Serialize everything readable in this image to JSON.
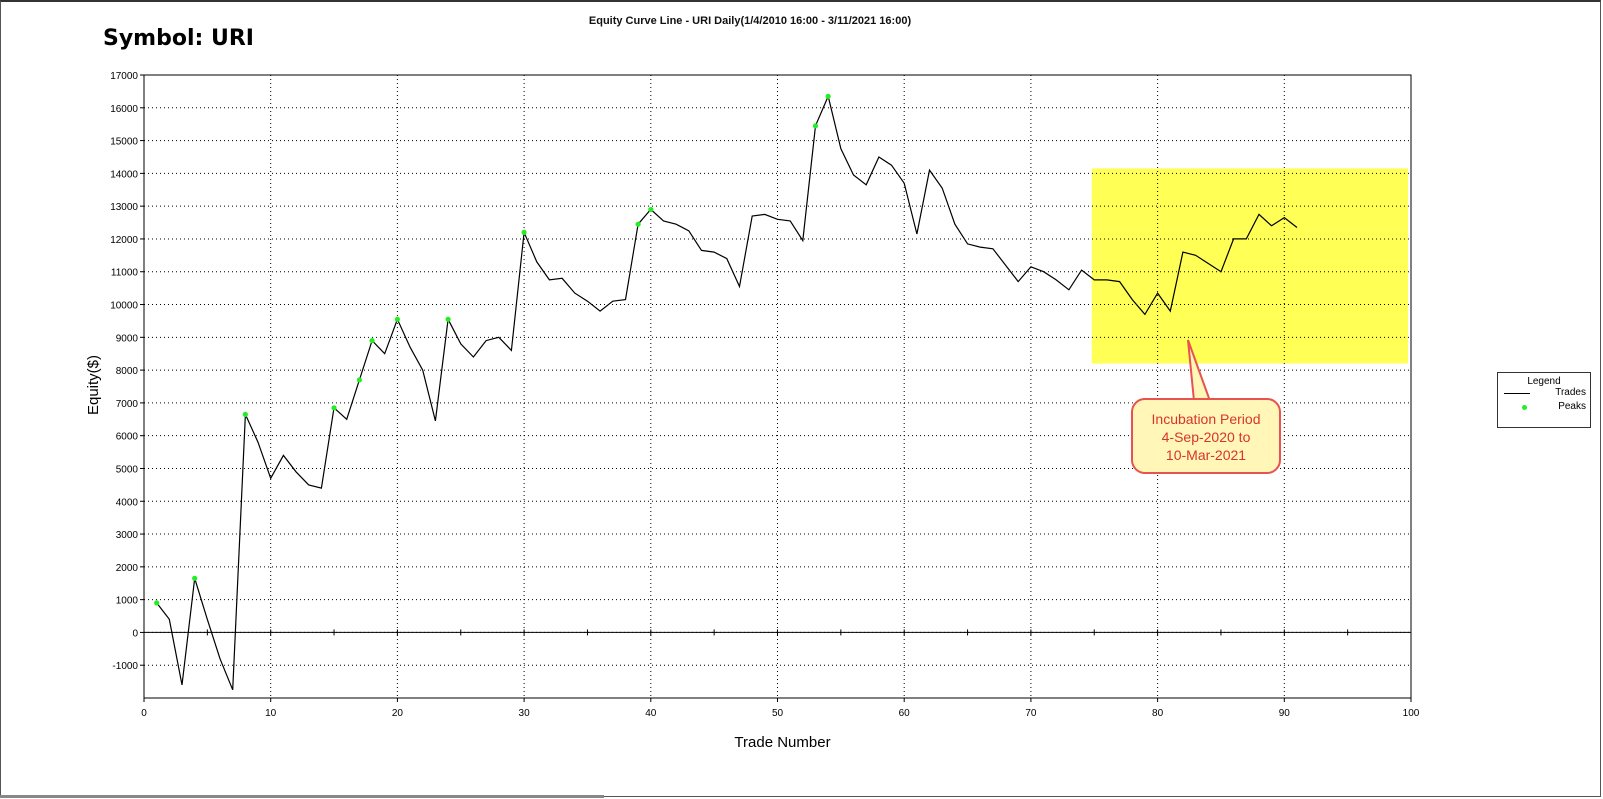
{
  "symbol_label": "Symbol: URI",
  "chart_data": {
    "type": "line",
    "title": "Equity Curve Line - URI Daily(1/4/2010 16:00 - 3/11/2021 16:00)",
    "xlabel": "Trade Number",
    "ylabel": "Equity($)",
    "xlim": [
      0,
      100
    ],
    "ylim": [
      -2000,
      17000
    ],
    "x_ticks": [
      0,
      10,
      20,
      30,
      40,
      50,
      60,
      70,
      80,
      90,
      100
    ],
    "y_ticks": [
      -1000,
      0,
      1000,
      2000,
      3000,
      4000,
      5000,
      6000,
      7000,
      8000,
      9000,
      10000,
      11000,
      12000,
      13000,
      14000,
      15000,
      16000,
      17000
    ],
    "grid": true,
    "legend_placement": "right",
    "series": [
      {
        "name": "Trades",
        "color": "#000000",
        "x": [
          1,
          2,
          3,
          4,
          5,
          6,
          7,
          8,
          9,
          10,
          11,
          12,
          13,
          14,
          15,
          16,
          17,
          18,
          19,
          20,
          21,
          22,
          23,
          24,
          25,
          26,
          27,
          28,
          29,
          30,
          31,
          32,
          33,
          34,
          35,
          36,
          37,
          38,
          39,
          40,
          41,
          42,
          43,
          44,
          45,
          46,
          47,
          48,
          49,
          50,
          51,
          52,
          53,
          54,
          55,
          56,
          57,
          58,
          59,
          60,
          61,
          62,
          63,
          64,
          65,
          66,
          67,
          68,
          69,
          70,
          71,
          72,
          73,
          74,
          75,
          76,
          77,
          78,
          79,
          80,
          81,
          82,
          83,
          84,
          85,
          86,
          87,
          88,
          89,
          90,
          91
        ],
        "y": [
          900,
          400,
          -1600,
          1650,
          400,
          -800,
          -1750,
          6650,
          5800,
          4700,
          5400,
          4900,
          4500,
          4400,
          6850,
          6500,
          7700,
          8900,
          8500,
          9550,
          8700,
          8000,
          6450,
          9550,
          8800,
          8400,
          8900,
          9000,
          8600,
          12200,
          11300,
          10750,
          10800,
          10350,
          10100,
          9800,
          10100,
          10150,
          12450,
          12900,
          12550,
          12450,
          12250,
          11650,
          11600,
          11400,
          10550,
          12700,
          12750,
          12600,
          12550,
          11950,
          15450,
          16350,
          14750,
          13950,
          13650,
          14500,
          14250,
          13700,
          12150,
          14100,
          13550,
          12450,
          11850,
          11750,
          11700,
          11200,
          10700,
          11150,
          11000,
          10750,
          10450,
          11050,
          10750,
          10750,
          10700,
          10150,
          9700,
          10350,
          9800,
          11600,
          11500,
          11250,
          11000,
          12000,
          12000,
          12750,
          12400,
          12650,
          12350
        ]
      },
      {
        "name": "Peaks",
        "color": "#22ee22",
        "x": [
          1,
          4,
          8,
          15,
          17,
          18,
          20,
          24,
          30,
          39,
          40,
          53,
          54
        ],
        "y": [
          900,
          1650,
          6650,
          6850,
          7700,
          8900,
          9550,
          9550,
          12200,
          12450,
          12900,
          15450,
          16350
        ]
      }
    ],
    "shaded_region": {
      "x_range": [
        74.8,
        100
      ],
      "y_range": [
        8200,
        14150
      ],
      "color": "#ffff55"
    },
    "annotation": {
      "lines": [
        "Incubation Period",
        "4-Sep-2020 to",
        "10-Mar-2021"
      ],
      "border_color": "#e8524f",
      "fill_color": "#fff6b8",
      "text_color": "#d9342b"
    }
  },
  "legend": {
    "title": "Legend",
    "items": [
      "Trades",
      "Peaks"
    ]
  }
}
